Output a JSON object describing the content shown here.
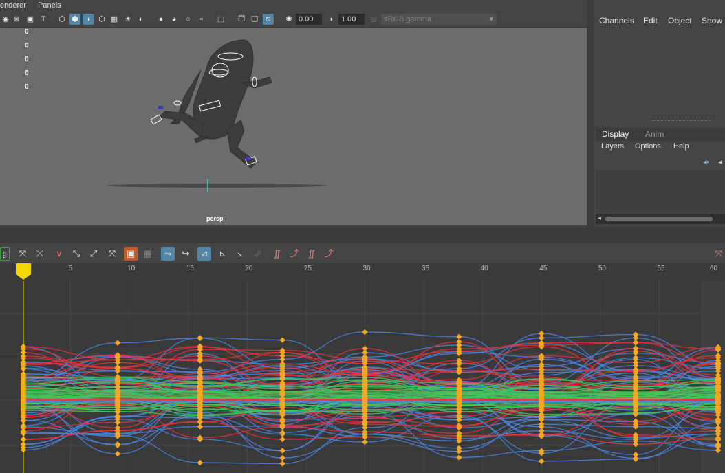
{
  "menubar": {
    "items": [
      "enderer",
      "Panels"
    ]
  },
  "view_toolbar": {
    "exposure_value": "0.00",
    "gamma_value": "1.00",
    "color_space": "sRGB gamma"
  },
  "viewport": {
    "hud_values": [
      "0",
      "0",
      "0",
      "0",
      "0"
    ],
    "camera_label": "persp"
  },
  "channel_box": {
    "menu": [
      "Channels",
      "Edit",
      "Object",
      "Show"
    ]
  },
  "layer_editor": {
    "tabs": [
      "Display",
      "Anim"
    ],
    "menu": [
      "Layers",
      "Options",
      "Help"
    ]
  },
  "graph_editor": {
    "current_frame": 1,
    "frame_range": [
      1,
      60
    ],
    "ruler_ticks": [
      "5",
      "10",
      "15",
      "20",
      "25",
      "30",
      "35",
      "40",
      "45",
      "50",
      "55",
      "60"
    ],
    "key_frames": [
      1,
      9,
      16,
      23,
      30,
      38,
      45,
      53,
      60
    ],
    "curve_colors": {
      "x": "#e8313a",
      "y": "#3fc85a",
      "z": "#4a86e8",
      "key": "#f5a623",
      "current": "#f5d800"
    }
  },
  "colors": {
    "accent": "#5285a6",
    "viewport_bg": "#6c6c6c",
    "graph_bg": "#393939"
  }
}
